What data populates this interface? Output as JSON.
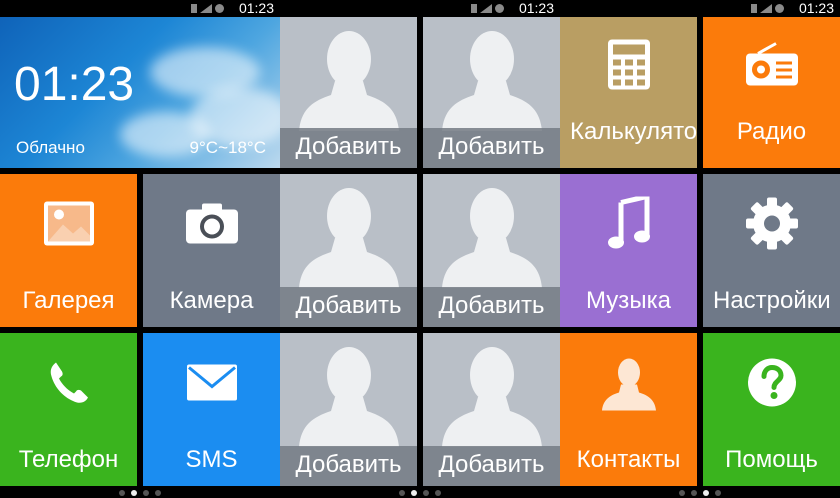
{
  "status_bar": {
    "time": "01:23"
  },
  "screens": [
    {
      "weather": {
        "time": "01:23",
        "condition": "Облачно",
        "temperature": "9°C~18°C"
      },
      "tiles": [
        {
          "label": "Галерея",
          "icon": "gallery-icon",
          "color": "#fb7b0b"
        },
        {
          "label": "Камера",
          "icon": "camera-icon",
          "color": "#6f7988"
        },
        {
          "label": "Телефон",
          "icon": "phone-icon",
          "color": "#3ab41e"
        },
        {
          "label": "SMS",
          "icon": "sms-icon",
          "color": "#1b8df1"
        }
      ]
    },
    {
      "contacts": [
        {
          "label": "Добавить"
        },
        {
          "label": "Добавить"
        },
        {
          "label": "Добавить"
        },
        {
          "label": "Добавить"
        },
        {
          "label": "Добавить"
        },
        {
          "label": "Добавить"
        }
      ]
    },
    {
      "tiles": [
        {
          "label": "Калькулятор",
          "icon": "calculator-icon",
          "color": "#b99e63"
        },
        {
          "label": "Радио",
          "icon": "radio-icon",
          "color": "#fb7b0b"
        },
        {
          "label": "Музыка",
          "icon": "music-icon",
          "color": "#9a6fd2"
        },
        {
          "label": "Настройки",
          "icon": "gear-icon",
          "color": "#6f7988"
        },
        {
          "label": "Контакты",
          "icon": "contacts-icon",
          "color": "#fb7b0b"
        },
        {
          "label": "Помощь",
          "icon": "help-icon",
          "color": "#3ab41e"
        }
      ]
    }
  ],
  "page_indicator": {
    "pages": 4,
    "active_index": [
      0,
      1,
      2
    ]
  }
}
